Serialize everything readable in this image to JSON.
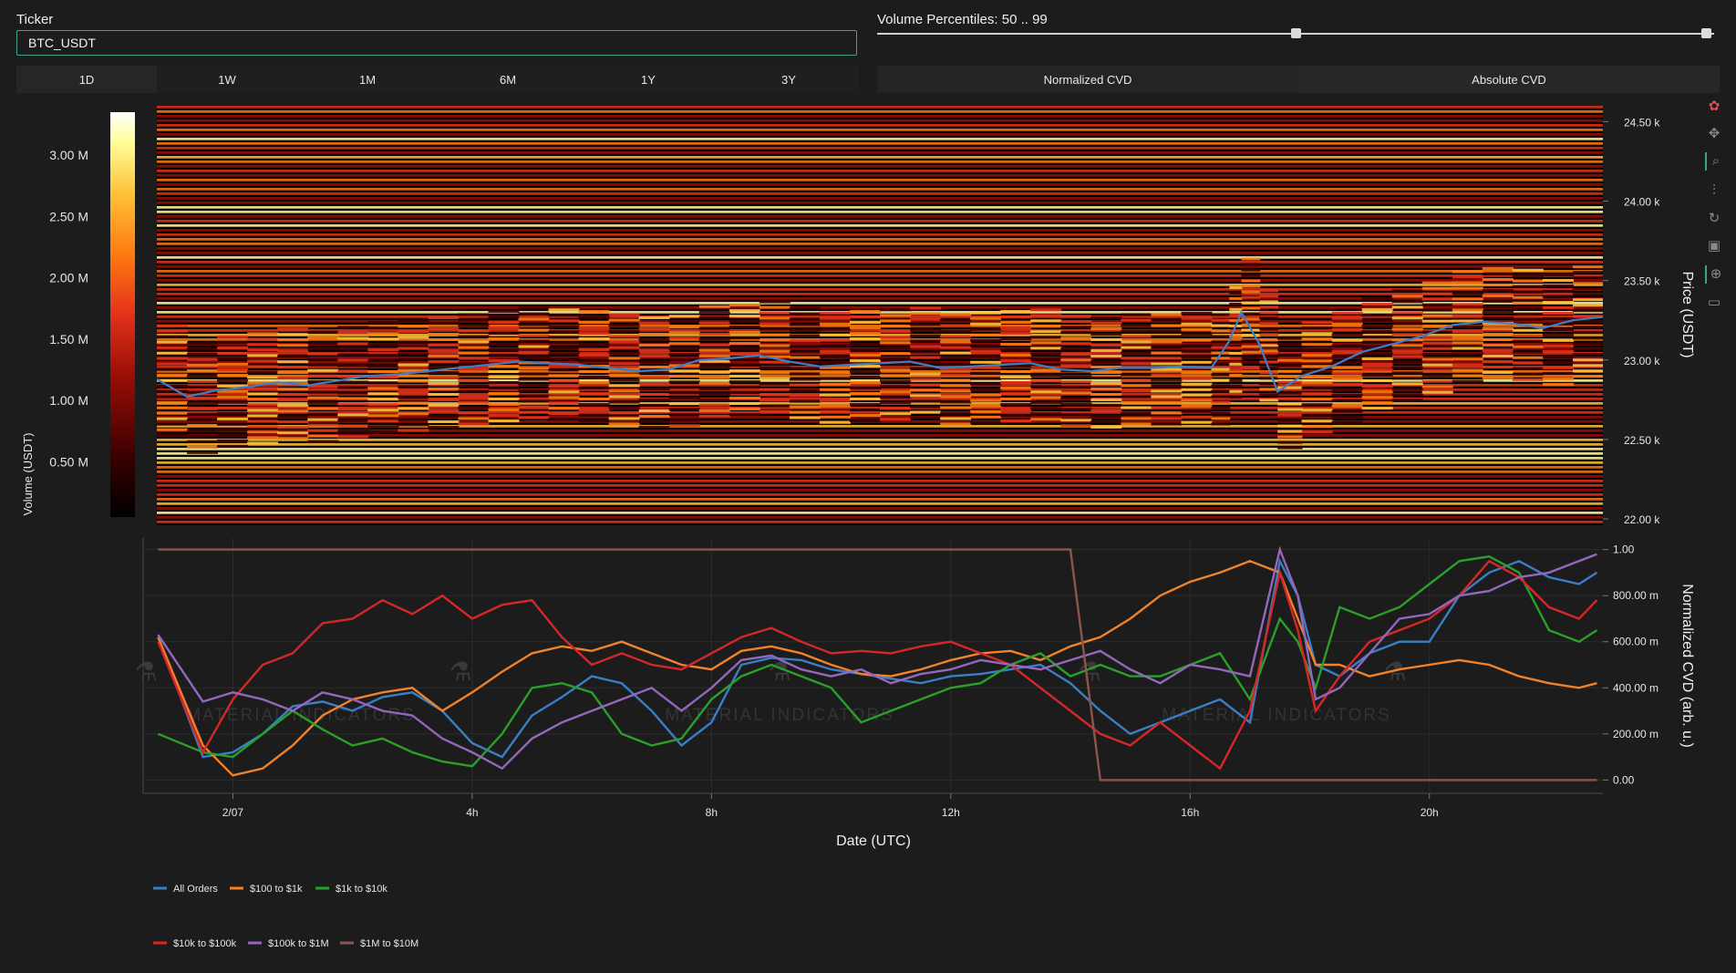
{
  "controls": {
    "ticker_label": "Ticker",
    "ticker_value": "BTC_USDT",
    "percentile_label": "Volume Percentiles: 50 .. 99",
    "percentile_range": [
      50,
      99
    ],
    "slider_range": [
      0,
      100
    ],
    "timeframes": [
      "1D",
      "1W",
      "1M",
      "6M",
      "1Y",
      "3Y"
    ],
    "active_timeframe": "1D",
    "cvd_modes": [
      "Normalized CVD",
      "Absolute CVD"
    ],
    "active_cvd_mode": "Normalized CVD"
  },
  "modebar": [
    "logo-icon",
    "pan-icon",
    "zoom-icon",
    "spike-lines-icon",
    "reset-icon",
    "save-icon",
    "crosshair-icon",
    "comment-icon"
  ],
  "watermark": "MATERIAL INDICATORS",
  "chart_data": [
    {
      "type": "heatmap",
      "title": "",
      "ylabel": "Price (USDT)",
      "y_ticks": [
        "22.00 k",
        "22.50 k",
        "23.00 k",
        "23.50 k",
        "24.00 k",
        "24.50 k"
      ],
      "y_tick_values": [
        22000,
        22500,
        23000,
        23500,
        24000,
        24500
      ],
      "ylim": [
        21960,
        24600
      ],
      "colorbar": {
        "label": "Volume (USDT)",
        "ticks": [
          "0.50 M",
          "1.00 M",
          "1.50 M",
          "2.00 M",
          "2.50 M",
          "3.00 M"
        ],
        "tick_values": [
          0.5,
          1.0,
          1.5,
          2.0,
          2.5,
          3.0
        ],
        "range": [
          0.05,
          3.35
        ],
        "colors": [
          "#000000",
          "#3a0000",
          "#9a0e05",
          "#e3321a",
          "#ff7a10",
          "#ffc23a",
          "#ffff9c",
          "#ffffff"
        ]
      },
      "price_line": {
        "color": "#3c7fc8",
        "x_hours": [
          0.0,
          0.5,
          1.0,
          1.5,
          2.0,
          2.5,
          3.0,
          3.5,
          4.0,
          4.5,
          5.0,
          5.5,
          6.0,
          6.5,
          7.0,
          7.5,
          8.0,
          8.5,
          9.0,
          9.5,
          10.0,
          10.5,
          11.0,
          11.5,
          12.0,
          12.5,
          13.0,
          13.5,
          14.0,
          14.5,
          15.0,
          15.5,
          16.0,
          16.5,
          17.0,
          17.5,
          17.8,
          18.0,
          18.3,
          18.6,
          19.0,
          19.5,
          20.0,
          20.5,
          21.0,
          21.5,
          22.0,
          22.5,
          23.0,
          23.5,
          24.0
        ],
        "price": [
          22880,
          22770,
          22810,
          22830,
          22860,
          22840,
          22870,
          22900,
          22910,
          22930,
          22950,
          22970,
          22990,
          22980,
          22970,
          22950,
          22930,
          22940,
          23000,
          23010,
          23030,
          22990,
          22960,
          22970,
          22980,
          22990,
          22950,
          22960,
          22970,
          22980,
          22940,
          22930,
          22950,
          22950,
          22960,
          22950,
          23120,
          23300,
          23100,
          22800,
          22900,
          22960,
          23050,
          23100,
          23150,
          23220,
          23240,
          23230,
          23200,
          23250,
          23270
        ]
      }
    },
    {
      "type": "line",
      "xlabel": "Date (UTC)",
      "ylabel": "Normalized CVD (arb. u.)",
      "x_ticks": [
        "2/07",
        "4h",
        "8h",
        "12h",
        "16h",
        "20h"
      ],
      "x_tick_hours": [
        0.5,
        4.5,
        8.5,
        12.5,
        16.5,
        20.5
      ],
      "xlim_hours": [
        -1,
        23.4
      ],
      "y_ticks": [
        "0.00",
        "200.00 m",
        "400.00 m",
        "600.00 m",
        "800.00 m",
        "1.00"
      ],
      "y_tick_values": [
        0,
        0.2,
        0.4,
        0.6,
        0.8,
        1.0
      ],
      "ylim": [
        -0.05,
        1.05
      ],
      "x_hours": [
        -0.75,
        0.0,
        0.5,
        1.0,
        1.5,
        2.0,
        2.5,
        3.0,
        3.5,
        4.0,
        4.5,
        5.0,
        5.5,
        6.0,
        6.5,
        7.0,
        7.5,
        8.0,
        8.5,
        9.0,
        9.5,
        10.0,
        10.5,
        11.0,
        11.5,
        12.0,
        12.5,
        13.0,
        13.5,
        14.0,
        14.5,
        15.0,
        15.5,
        16.0,
        16.5,
        17.0,
        17.5,
        18.0,
        18.3,
        18.6,
        19.0,
        19.5,
        20.0,
        20.5,
        21.0,
        21.5,
        22.0,
        22.5,
        23.0,
        23.3
      ],
      "series": [
        {
          "name": "All Orders",
          "color": "#3a7fc5",
          "values": [
            0.62,
            0.1,
            0.12,
            0.2,
            0.32,
            0.34,
            0.3,
            0.36,
            0.38,
            0.3,
            0.16,
            0.1,
            0.28,
            0.36,
            0.45,
            0.42,
            0.3,
            0.15,
            0.25,
            0.5,
            0.53,
            0.52,
            0.48,
            0.46,
            0.44,
            0.42,
            0.45,
            0.46,
            0.48,
            0.5,
            0.42,
            0.3,
            0.2,
            0.25,
            0.3,
            0.35,
            0.25,
            0.95,
            0.8,
            0.5,
            0.45,
            0.55,
            0.6,
            0.6,
            0.8,
            0.9,
            0.95,
            0.88,
            0.85,
            0.9
          ]
        },
        {
          "name": "$100 to $1k",
          "color": "#f0822a",
          "values": [
            0.62,
            0.15,
            0.02,
            0.05,
            0.15,
            0.28,
            0.35,
            0.38,
            0.4,
            0.3,
            0.38,
            0.47,
            0.55,
            0.58,
            0.56,
            0.6,
            0.55,
            0.5,
            0.48,
            0.56,
            0.58,
            0.55,
            0.5,
            0.46,
            0.45,
            0.48,
            0.52,
            0.55,
            0.56,
            0.52,
            0.58,
            0.62,
            0.7,
            0.8,
            0.86,
            0.9,
            0.95,
            0.9,
            0.7,
            0.5,
            0.5,
            0.45,
            0.48,
            0.5,
            0.52,
            0.5,
            0.45,
            0.42,
            0.4,
            0.42
          ]
        },
        {
          "name": "$1k to $10k",
          "color": "#2aa02b",
          "values": [
            0.2,
            0.12,
            0.1,
            0.2,
            0.3,
            0.22,
            0.15,
            0.18,
            0.12,
            0.08,
            0.06,
            0.2,
            0.4,
            0.42,
            0.38,
            0.2,
            0.15,
            0.18,
            0.35,
            0.45,
            0.5,
            0.45,
            0.4,
            0.25,
            0.3,
            0.35,
            0.4,
            0.42,
            0.5,
            0.55,
            0.45,
            0.5,
            0.45,
            0.45,
            0.5,
            0.55,
            0.35,
            0.7,
            0.6,
            0.4,
            0.75,
            0.7,
            0.75,
            0.85,
            0.95,
            0.97,
            0.9,
            0.65,
            0.6,
            0.65
          ]
        },
        {
          "name": "$10k to $100k",
          "color": "#d62728",
          "values": [
            0.6,
            0.12,
            0.35,
            0.5,
            0.55,
            0.68,
            0.7,
            0.78,
            0.72,
            0.8,
            0.7,
            0.76,
            0.78,
            0.62,
            0.5,
            0.55,
            0.5,
            0.48,
            0.55,
            0.62,
            0.66,
            0.6,
            0.55,
            0.56,
            0.55,
            0.58,
            0.6,
            0.55,
            0.5,
            0.4,
            0.3,
            0.2,
            0.15,
            0.25,
            0.15,
            0.05,
            0.3,
            0.9,
            0.65,
            0.3,
            0.45,
            0.6,
            0.65,
            0.7,
            0.8,
            0.95,
            0.88,
            0.75,
            0.7,
            0.78
          ]
        },
        {
          "name": "$100k to $1M",
          "color": "#9467bd",
          "values": [
            0.63,
            0.34,
            0.38,
            0.35,
            0.3,
            0.38,
            0.35,
            0.3,
            0.28,
            0.18,
            0.12,
            0.05,
            0.18,
            0.25,
            0.3,
            0.35,
            0.4,
            0.3,
            0.4,
            0.52,
            0.54,
            0.48,
            0.45,
            0.48,
            0.42,
            0.46,
            0.48,
            0.52,
            0.5,
            0.48,
            0.52,
            0.56,
            0.48,
            0.42,
            0.5,
            0.48,
            0.45,
            1.0,
            0.8,
            0.35,
            0.4,
            0.55,
            0.7,
            0.72,
            0.8,
            0.82,
            0.88,
            0.9,
            0.95,
            0.98
          ]
        },
        {
          "name": "$1M to $10M",
          "color": "#8c564b",
          "values": [
            1.0,
            1.0,
            1.0,
            1.0,
            1.0,
            1.0,
            1.0,
            1.0,
            1.0,
            1.0,
            1.0,
            1.0,
            1.0,
            1.0,
            1.0,
            1.0,
            1.0,
            1.0,
            1.0,
            1.0,
            1.0,
            1.0,
            1.0,
            1.0,
            1.0,
            1.0,
            1.0,
            1.0,
            1.0,
            1.0,
            1.0,
            0.0,
            0.0,
            0.0,
            0.0,
            0.0,
            0.0,
            0.0,
            0.0,
            0.0,
            0.0,
            0.0,
            0.0,
            0.0,
            0.0,
            0.0,
            0.0,
            0.0,
            0.0,
            0.0
          ]
        }
      ],
      "legend_position": "bottom-left"
    }
  ]
}
